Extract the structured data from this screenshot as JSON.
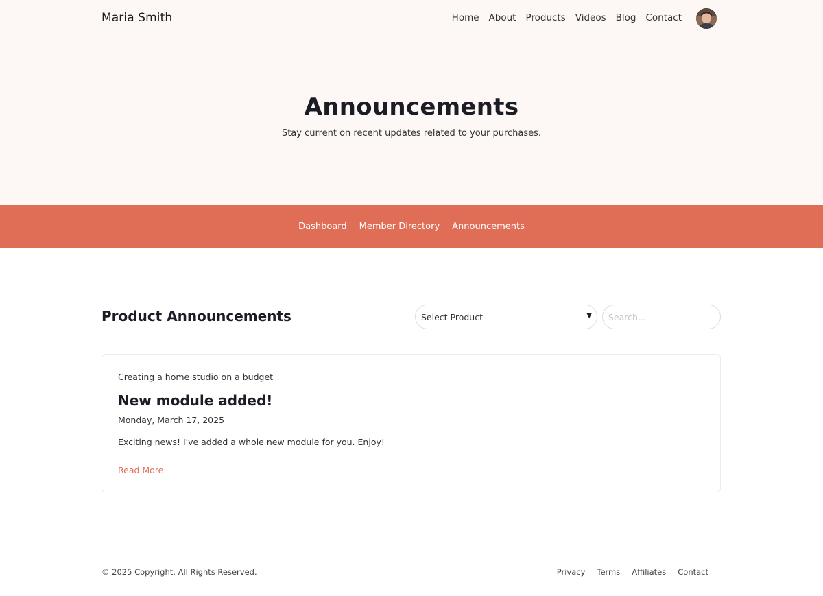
{
  "header": {
    "brand": "Maria Smith",
    "nav": [
      "Home",
      "About",
      "Products",
      "Videos",
      "Blog",
      "Contact"
    ]
  },
  "hero": {
    "title": "Announcements",
    "subtitle": "Stay current on recent updates related to your purchases."
  },
  "subnav": [
    "Dashboard",
    "Member Directory",
    "Announcements"
  ],
  "section": {
    "title": "Product Announcements",
    "select_value": "Select Product",
    "search_placeholder": "Search..."
  },
  "announcement": {
    "product": "Creating a home studio on a budget",
    "title": "New module added!",
    "date": "Monday, March 17, 2025",
    "body": "Exciting news! I've added a whole new module for you. Enjoy!",
    "link": "Read More"
  },
  "footer": {
    "copyright": "© 2025 Copyright. All Rights Reserved.",
    "links": [
      "Privacy",
      "Terms",
      "Affiliates",
      "Contact"
    ]
  },
  "colors": {
    "accent": "#e06e56",
    "hero_bg": "#fdf8f5"
  }
}
